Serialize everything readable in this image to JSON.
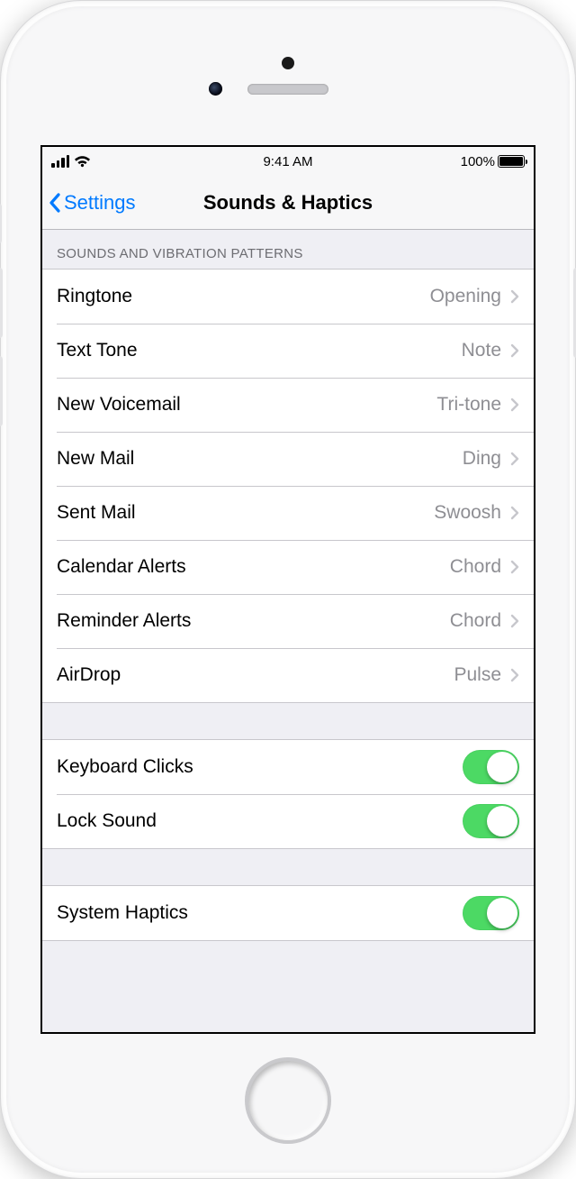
{
  "statusbar": {
    "time": "9:41 AM",
    "battery_pct": "100%"
  },
  "nav": {
    "back_label": "Settings",
    "title": "Sounds & Haptics"
  },
  "section_header": "SOUNDS AND VIBRATION PATTERNS",
  "sounds": [
    {
      "label": "Ringtone",
      "value": "Opening"
    },
    {
      "label": "Text Tone",
      "value": "Note"
    },
    {
      "label": "New Voicemail",
      "value": "Tri-tone"
    },
    {
      "label": "New Mail",
      "value": "Ding"
    },
    {
      "label": "Sent Mail",
      "value": "Swoosh"
    },
    {
      "label": "Calendar Alerts",
      "value": "Chord"
    },
    {
      "label": "Reminder Alerts",
      "value": "Chord"
    },
    {
      "label": "AirDrop",
      "value": "Pulse"
    }
  ],
  "toggles_a": [
    {
      "label": "Keyboard Clicks",
      "on": true
    },
    {
      "label": "Lock Sound",
      "on": true
    }
  ],
  "toggles_b": [
    {
      "label": "System Haptics",
      "on": true
    }
  ]
}
